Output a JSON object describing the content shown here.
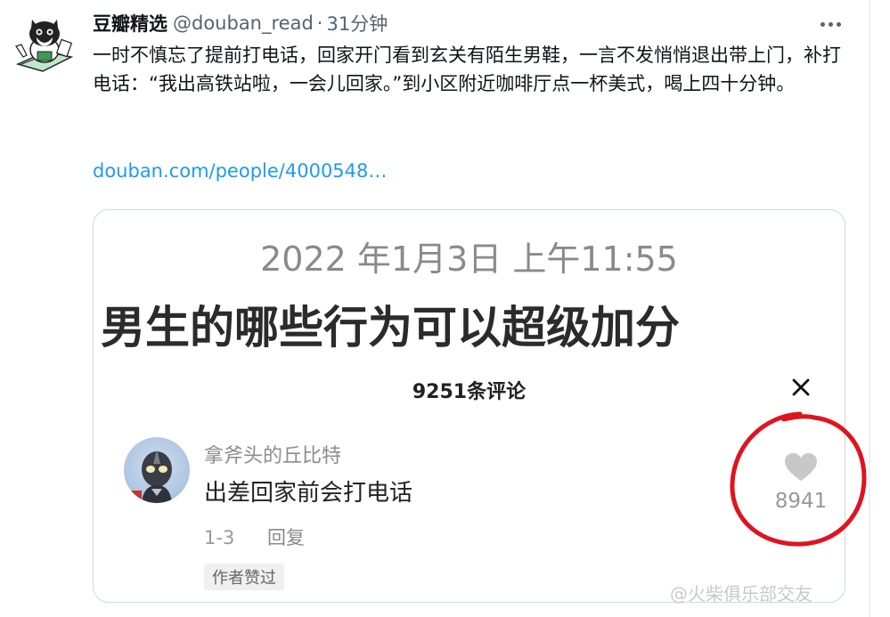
{
  "tweet": {
    "display_name": "豆瓣精选",
    "handle": "@douban_read",
    "separator": "·",
    "time": "31分钟",
    "text": "一时不慎忘了提前打电话，回家开门看到玄关有陌生男鞋，一言不发悄悄退出带上门，补打电话：“我出高铁站啦，一会儿回家。”到小区附近咖啡厅点一杯美式，喝上四十分钟。",
    "link": "douban.com/people/4000548…"
  },
  "card": {
    "date": "2022 年1月3日 上午11:55",
    "title": "男生的哪些行为可以超级加分",
    "comment_count": "9251条评论",
    "comment": {
      "author": "拿斧头的丘比特",
      "text": "出差回家前会打电话",
      "index": "1-3",
      "reply_label": "回复",
      "badge": "作者赞过",
      "likes": "8941"
    }
  },
  "watermark": "@火柴俱乐部交友",
  "icons": {
    "more": "more-horizontal-icon",
    "close": "close-icon",
    "like": "heart-icon"
  },
  "colors": {
    "link": "#1d9bf0",
    "annotation": "#e0141e",
    "secondary_text": "#536471"
  }
}
